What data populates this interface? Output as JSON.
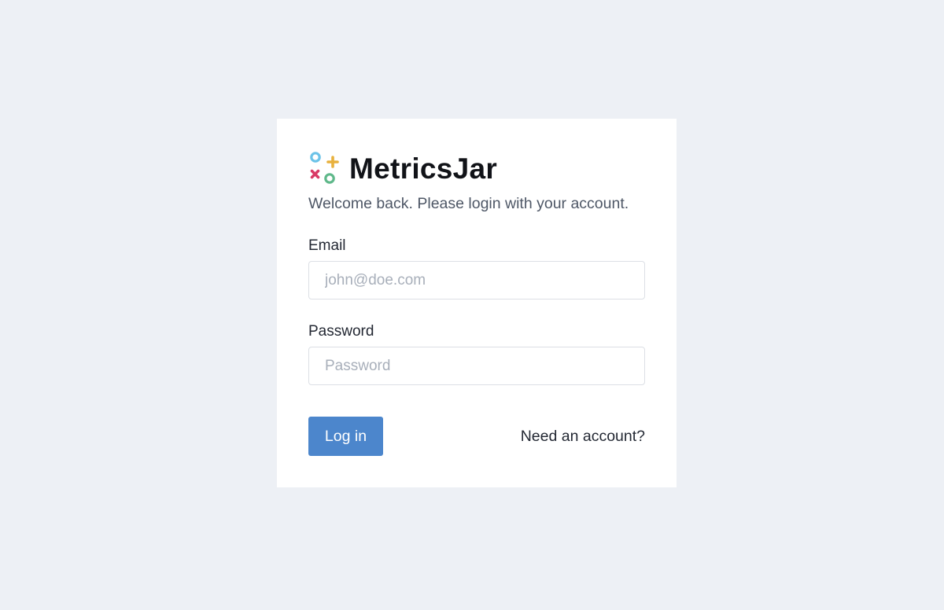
{
  "brand": {
    "name": "MetricsJar",
    "logo_icon": "metricsjar-logo-icon",
    "logo_colors": {
      "ring_top": "#6cc3e8",
      "plus": "#e8b13d",
      "cross": "#d93a66",
      "ring_bottom": "#5fb88a"
    }
  },
  "login": {
    "tagline": "Welcome back. Please login with your account.",
    "email_label": "Email",
    "email_placeholder": "john@doe.com",
    "email_value": "",
    "password_label": "Password",
    "password_placeholder": "Password",
    "password_value": "",
    "submit_label": "Log in",
    "signup_link": "Need an account?"
  },
  "colors": {
    "page_background": "#edf0f5",
    "card_background": "#ffffff",
    "primary_button": "#4c86cc",
    "input_border": "#dcdfe5",
    "placeholder_text": "#a8afba"
  }
}
